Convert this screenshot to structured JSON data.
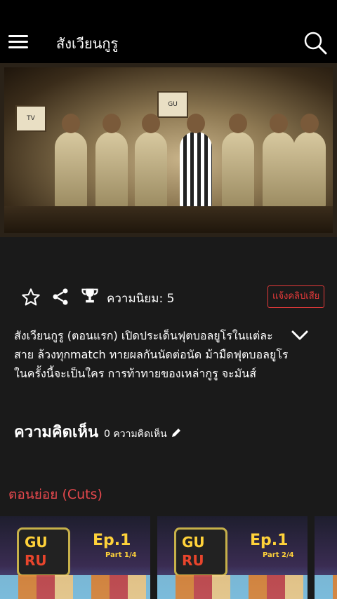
{
  "app_bar": {
    "title": "สังเวียนกูรู"
  },
  "actions": {
    "popularity_text": "ความนิยม: 5",
    "report_label": "แจ้งคลิปเสีย"
  },
  "description": "สังเวียนกูรู (ตอนแรก) เปิดประเด็นฟุตบอลยูโรในแต่ละสาย ล้วงทุกmatch ทายผลกันนัดต่อนัด ม้ามืดฟุตบอลยูโรในครั้งนี้จะเป็นใคร การท้าทายของเหล่ากูรู จะมันส์",
  "comments": {
    "title": "ความคิดเห็น",
    "count_text": "0 ความคิดเห็น"
  },
  "cuts": {
    "title": "ตอนย่อย (Cuts)",
    "items": [
      {
        "logo_top": "GU",
        "logo_bottom": "RU",
        "ep": "Ep.1",
        "part": "Part 1/4"
      },
      {
        "logo_top": "GU",
        "logo_bottom": "RU",
        "ep": "Ep.1",
        "part": "Part 2/4"
      }
    ]
  },
  "hero_signs": [
    "TV",
    "GU"
  ],
  "icons": [
    "menu-icon",
    "search-icon",
    "star-icon",
    "share-icon",
    "trophy-icon",
    "chevron-down-icon",
    "pencil-icon"
  ],
  "colors": {
    "accent": "#e5484d",
    "report": "#e53a3a",
    "appbar": "#000000",
    "background": "#1a1a1a"
  }
}
